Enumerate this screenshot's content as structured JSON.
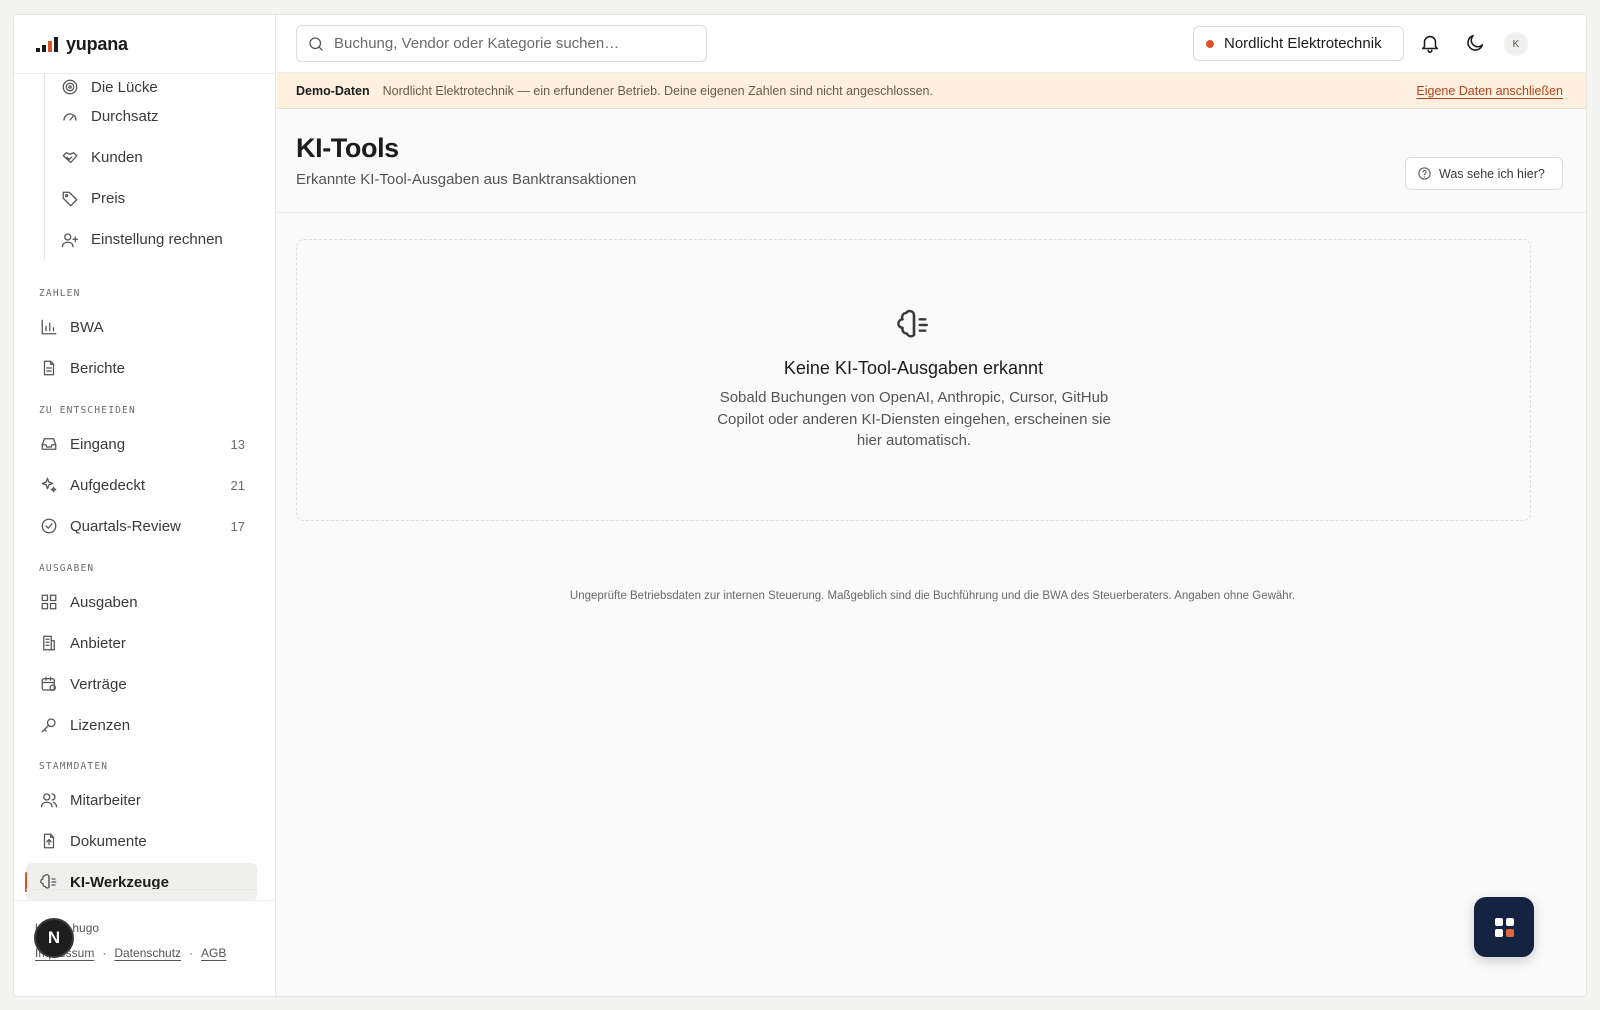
{
  "brand": {
    "name": "yupana"
  },
  "sidebar": {
    "sub_items": [
      {
        "label": "Die Lücke",
        "icon": "target-icon"
      },
      {
        "label": "Durchsatz",
        "icon": "gauge-icon"
      },
      {
        "label": "Kunden",
        "icon": "handshake-icon"
      },
      {
        "label": "Preis",
        "icon": "tag-icon"
      },
      {
        "label": "Einstellung rechnen",
        "icon": "user-plus-icon"
      }
    ],
    "sections": [
      {
        "label": "ZAHLEN",
        "items": [
          {
            "label": "BWA",
            "icon": "bar-chart-icon"
          },
          {
            "label": "Berichte",
            "icon": "file-text-icon"
          }
        ]
      },
      {
        "label": "ZU ENTSCHEIDEN",
        "items": [
          {
            "label": "Eingang",
            "icon": "inbox-icon",
            "count": "13"
          },
          {
            "label": "Aufgedeckt",
            "icon": "sparkles-icon",
            "count": "21"
          },
          {
            "label": "Quartals-Review",
            "icon": "check-circle-icon",
            "count": "17"
          }
        ]
      },
      {
        "label": "AUSGABEN",
        "items": [
          {
            "label": "Ausgaben",
            "icon": "grid-icon"
          },
          {
            "label": "Anbieter",
            "icon": "building-icon"
          },
          {
            "label": "Verträge",
            "icon": "calendar-icon"
          },
          {
            "label": "Lizenzen",
            "icon": "key-icon"
          }
        ]
      },
      {
        "label": "STAMMDATEN",
        "items": [
          {
            "label": "Mitarbeiter",
            "icon": "users-icon"
          },
          {
            "label": "Dokumente",
            "icon": "file-upload-icon"
          },
          {
            "label": "KI-Werkzeuge",
            "icon": "brain-icon",
            "active": true
          }
        ]
      }
    ],
    "footer": {
      "user": "ludwig.hugo",
      "links": [
        "Impressum",
        "Datenschutz",
        "AGB"
      ],
      "badge": "N"
    }
  },
  "topbar": {
    "search_placeholder": "Buchung, Vendor oder Kategorie suchen…",
    "company": "Nordlicht Elektrotechnik",
    "avatar": "K"
  },
  "banner": {
    "tag": "Demo-Daten",
    "message": "Nordlicht Elektrotechnik — ein erfundener Betrieb. Deine eigenen Zahlen sind nicht angeschlossen.",
    "cta": "Eigene Daten anschließen"
  },
  "page": {
    "title": "KI-Tools",
    "subtitle": "Erkannte KI-Tool-Ausgaben aus Banktransaktionen",
    "help": "Was sehe ich hier?"
  },
  "empty_state": {
    "title": "Keine KI-Tool-Ausgaben erkannt",
    "text": "Sobald Buchungen von OpenAI, Anthropic, Cursor, GitHub Copilot oder anderen KI-Diensten eingehen, erscheinen sie hier automatisch."
  },
  "disclaimer": "Ungeprüfte Betriebsdaten zur internen Steuerung. Maßgeblich sind die Buchführung und die BWA des Steuerberaters. Angaben ohne Gewähr.",
  "colors": {
    "accent": "#d9542b",
    "fab": "#14233f",
    "banner_bg": "#fdf0df"
  }
}
